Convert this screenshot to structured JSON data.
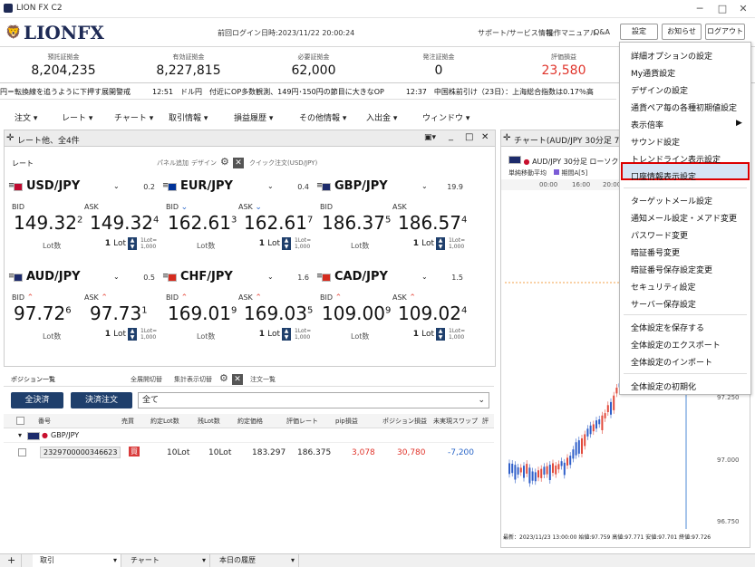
{
  "app_title": "LION FX C2",
  "logo_text": "LIONFX",
  "last_login": "前回ログイン日時:2023/11/22 20:00:24",
  "top_links": [
    "サポート/サービス情報",
    "操作マニュアル",
    "Q&A"
  ],
  "top_buttons": [
    "設定",
    "お知らせ",
    "ログアウト"
  ],
  "summary": [
    {
      "label": "預託証拠金",
      "value": "8,204,235",
      "color": "#111111"
    },
    {
      "label": "有効証拠金",
      "value": "8,227,815",
      "color": "#111111"
    },
    {
      "label": "必要証拠金",
      "value": "62,000",
      "color": "#111111"
    },
    {
      "label": "発注証拠金",
      "value": "0",
      "color": "#111111"
    },
    {
      "label": "評価損益",
      "value": "23,580",
      "color": "#e0342b"
    }
  ],
  "ticker": "円＝転換線を追うように下押す展開警戒　　　12:51　ドル円　付近にOP多数観測、149円･150円の節目に大きなOP　　　12:37　中国株前引け（23日）：上海総合指数は0.17％高",
  "menu": [
    "注文",
    "レート",
    "チャート",
    "取引情報",
    "損益履歴",
    "その他情報",
    "入出金",
    "ウィンドウ"
  ],
  "rate_panel": {
    "title": "レート他、全4件",
    "tab": "レート",
    "links": [
      "パネル追加",
      "デザイン"
    ],
    "quick_order": "クイック注文(USD/JPY)",
    "bid_label": "BID",
    "ask_label": "ASK",
    "lot_label": "Lot数",
    "lot_value": "1",
    "lot_unit": "Lot",
    "lot_note": "1Lot=\n1,000",
    "cards": [
      {
        "pair": "USD/JPY",
        "spread": "0.2",
        "bid_main": "149.32",
        "bid_sub": "2",
        "ask_main": "149.32",
        "ask_sub": "4",
        "dir": ""
      },
      {
        "pair": "EUR/JPY",
        "spread": "0.4",
        "bid_main": "162.61",
        "bid_sub": "3",
        "ask_main": "162.61",
        "ask_sub": "7",
        "dir": "down"
      },
      {
        "pair": "GBP/JPY",
        "spread": "19.9",
        "bid_main": "186.37",
        "bid_sub": "5",
        "ask_main": "186.57",
        "ask_sub": "4",
        "dir": ""
      },
      {
        "pair": "AUD/JPY",
        "spread": "0.5",
        "bid_main": "97.72",
        "bid_sub": "6",
        "ask_main": "97.73",
        "ask_sub": "1",
        "dir": "up"
      },
      {
        "pair": "CHF/JPY",
        "spread": "1.6",
        "bid_main": "169.01",
        "bid_sub": "9",
        "ask_main": "169.03",
        "ask_sub": "5",
        "dir": "up"
      },
      {
        "pair": "CAD/JPY",
        "spread": "1.5",
        "bid_main": "109.00",
        "bid_sub": "9",
        "ask_main": "109.02",
        "ask_sub": "4",
        "dir": "up"
      }
    ]
  },
  "position_panel": {
    "tab": "ポジション一覧",
    "links": [
      "全展開切替",
      "集計表示切替"
    ],
    "order_tab": "注文一覧",
    "btn_all_close": "全決済",
    "btn_close_order": "決済注文",
    "filter": "全て",
    "columns": [
      "番号",
      "売買",
      "約定Lot数",
      "残Lot数",
      "約定価格",
      "評価レート",
      "pip損益",
      "ポジション損益",
      "未実現スワップ",
      "評"
    ],
    "group": "GBP/JPY",
    "rows": [
      {
        "id": "2329700000346623",
        "side": "買",
        "lot": "10Lot",
        "remain": "10Lot",
        "price": "183.297",
        "rate": "186.375",
        "pip": "3,078",
        "pl": "30,780",
        "swap": "-7,200"
      }
    ]
  },
  "chart_panel": {
    "title": "チャート(AUD/JPY 30分足 75/",
    "sub": "AUD/JPY 30分足 ローソク B",
    "legend": [
      "単純移動平均",
      "期間A[5]"
    ],
    "times": [
      "00:00",
      "16:00",
      "20:00"
    ],
    "prices": [
      "97.250",
      "97.000",
      "96.750"
    ],
    "footer": "最新：2023/11/23 13:00:00 始値:97.759 高値:97.771 安値:97.701 終値:97.726"
  },
  "dropdown": [
    "詳細オプションの設定",
    "My通貨設定",
    "デザインの設定",
    "通貨ペア毎の各種初期値設定",
    "表示倍率",
    "サウンド設定",
    "トレンドライン表示設定",
    "口座情報表示設定",
    "ターゲットメール設定",
    "通知メール設定・メアド変更",
    "パスワード変更",
    "暗証番号変更",
    "暗証番号保存設定変更",
    "セキュリティ設定",
    "サーバー保存設定",
    "全体設定を保存する",
    "全体設定のエクスポート",
    "全体設定のインポート",
    "全体設定の初期化"
  ],
  "bottom_tabs": [
    "取引",
    "チャート",
    "本日の履歴"
  ]
}
